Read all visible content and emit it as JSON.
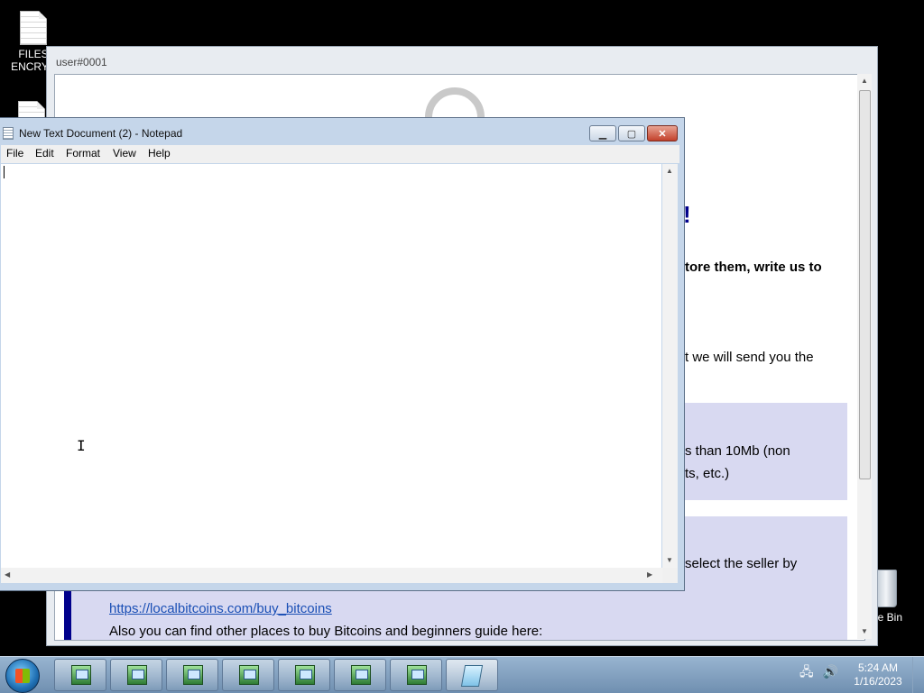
{
  "desktop": {
    "icons": [
      {
        "label_line1": "FILES",
        "label_line2": "ENCRYP"
      },
      {
        "label": "cle Bin"
      }
    ]
  },
  "ransom_window": {
    "title": "user#0001",
    "fragments": {
      "heading_end": "!",
      "line1": "tore them, write us to",
      "line2": "t we will send you the",
      "box_line1": "s than 10Mb (non",
      "box_line2": "ts, etc.)",
      "seller_line": "select the seller by",
      "link": "https://localbitcoins.com/buy_bitcoins",
      "guide_line": "Also you can find other places to buy Bitcoins and beginners guide here:"
    }
  },
  "notepad": {
    "title": "New Text Document (2) - Notepad",
    "menu": [
      "File",
      "Edit",
      "Format",
      "View",
      "Help"
    ],
    "content": ""
  },
  "taskbar": {
    "buttons": 8,
    "time": "5:24 AM",
    "date": "1/16/2023"
  },
  "colors": {
    "notepad_frame": "#c5d6ea",
    "highlight_box": "#d8d9f1",
    "accent_bar": "#00008b",
    "link": "#1a4fb5"
  }
}
